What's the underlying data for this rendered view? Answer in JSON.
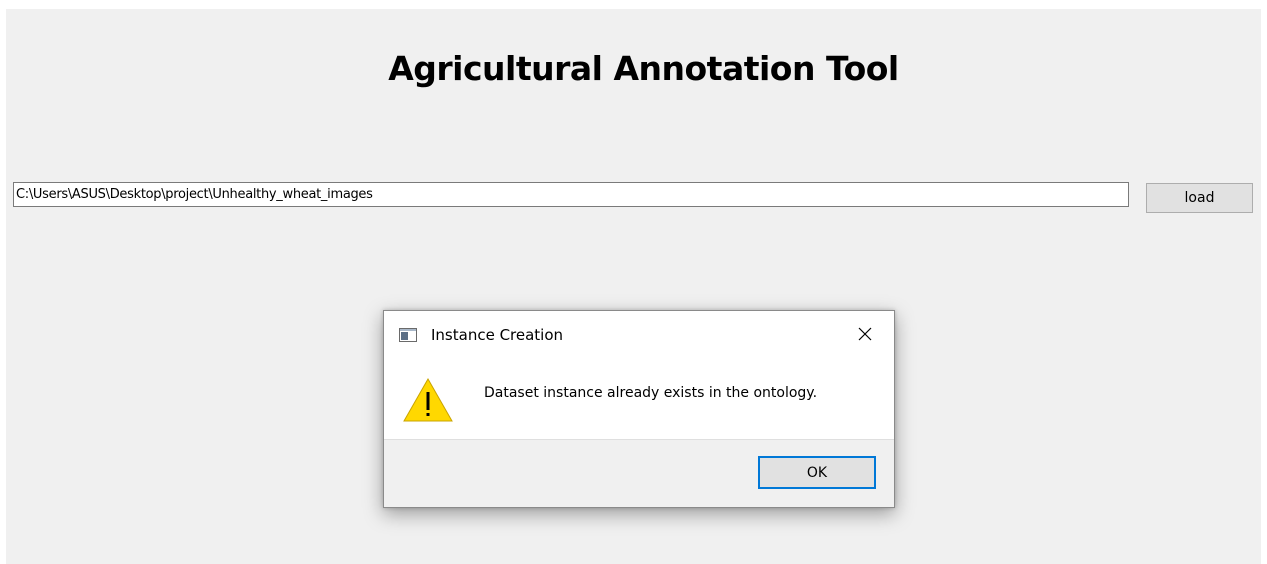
{
  "app": {
    "title": "Agricultural Annotation Tool",
    "path_value": "C:\\Users\\ASUS\\Desktop\\project\\Unhealthy_wheat_images",
    "load_label": "load"
  },
  "dialog": {
    "title": "Instance Creation",
    "message": "Dataset instance already exists in the ontology.",
    "ok_label": "OK",
    "icon": "warning-icon",
    "close_icon": "close-icon"
  },
  "colors": {
    "window_bg": "#f0f0f0",
    "focus_accent": "#0078d7",
    "warning_yellow": "#ffd800"
  }
}
